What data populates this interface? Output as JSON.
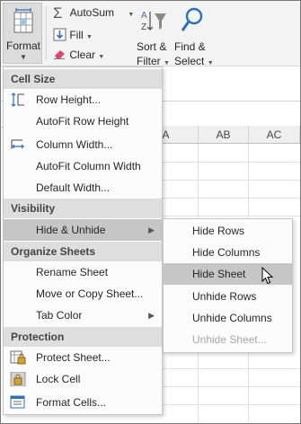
{
  "ribbon": {
    "format_label": "Format",
    "autosum_label": "AutoSum",
    "fill_label": "Fill",
    "clear_label": "Clear",
    "sort_filter_line1": "Sort &",
    "sort_filter_line2": "Filter",
    "find_select_line1": "Find &",
    "find_select_line2": "Select"
  },
  "columns": [
    "AA",
    "AB",
    "AC"
  ],
  "format_menu": {
    "sections": {
      "cell_size": "Cell Size",
      "visibility": "Visibility",
      "organize": "Organize Sheets",
      "protection": "Protection"
    },
    "items": {
      "row_height": "Row Height...",
      "autofit_row_height": "AutoFit Row Height",
      "column_width": "Column Width...",
      "autofit_column_width": "AutoFit Column Width",
      "default_width": "Default Width...",
      "hide_unhide": "Hide & Unhide",
      "rename_sheet": "Rename Sheet",
      "move_copy_sheet": "Move or Copy Sheet...",
      "tab_color": "Tab Color",
      "protect_sheet": "Protect Sheet...",
      "lock_cell": "Lock Cell",
      "format_cells": "Format Cells..."
    }
  },
  "hide_submenu": {
    "items": {
      "hide_rows": "Hide Rows",
      "hide_columns": "Hide Columns",
      "hide_sheet": "Hide Sheet",
      "unhide_rows": "Unhide Rows",
      "unhide_columns": "Unhide Columns",
      "unhide_sheet": "Unhide Sheet..."
    },
    "highlighted": "hide_sheet",
    "disabled": [
      "unhide_sheet"
    ]
  },
  "colors": {
    "ribbon_bg": "#f3f3f3",
    "section_bg": "#dedede",
    "highlight_bg": "#c6c6c6",
    "icon_blue": "#2f6eb8",
    "autosum_gray": "#5a5a5a",
    "clear_pink": "#e0466a"
  },
  "icons": {
    "format": "format-cells-icon",
    "autosum": "sigma-icon",
    "fill": "fill-down-icon",
    "clear": "eraser-icon",
    "sort_filter": "sort-filter-icon",
    "find_select": "magnifier-icon"
  }
}
